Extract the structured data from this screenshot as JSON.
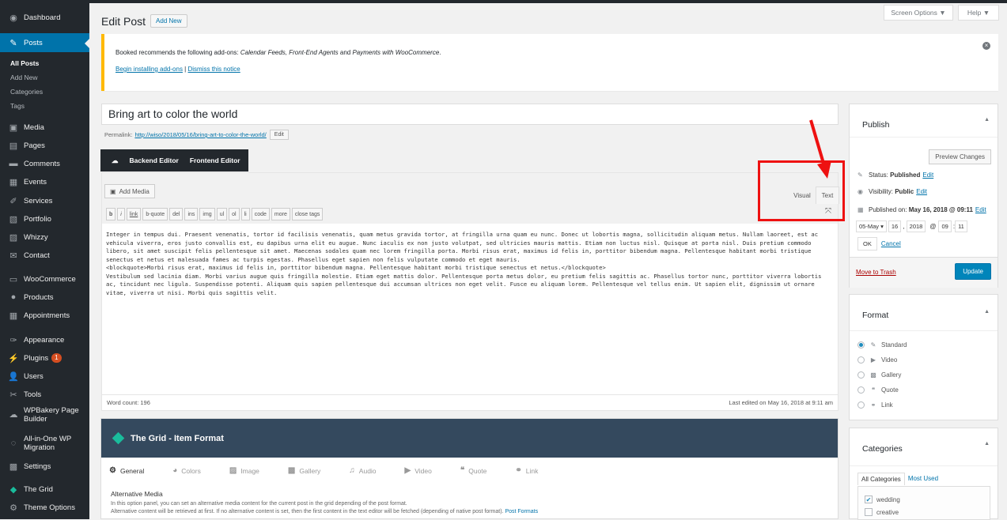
{
  "admin_menu": {
    "items": [
      {
        "label": "Dashboard",
        "icon": "dashboard-icon"
      },
      {
        "label": "Posts",
        "icon": "pin-icon"
      },
      {
        "label": "Media",
        "icon": "media-icon"
      },
      {
        "label": "Pages",
        "icon": "pages-icon"
      },
      {
        "label": "Comments",
        "icon": "comments-icon"
      },
      {
        "label": "Events",
        "icon": "calendar-icon"
      },
      {
        "label": "Services",
        "icon": "services-icon"
      },
      {
        "label": "Portfolio",
        "icon": "portfolio-icon"
      },
      {
        "label": "Whizzy",
        "icon": "whizzy-icon"
      },
      {
        "label": "Contact",
        "icon": "mail-icon"
      },
      {
        "label": "WooCommerce",
        "icon": "woo-icon"
      },
      {
        "label": "Products",
        "icon": "products-icon"
      },
      {
        "label": "Appointments",
        "icon": "calendar-icon"
      },
      {
        "label": "Appearance",
        "icon": "brush-icon"
      },
      {
        "label": "Plugins",
        "icon": "plugin-icon",
        "badge": "1"
      },
      {
        "label": "Users",
        "icon": "users-icon"
      },
      {
        "label": "Tools",
        "icon": "tools-icon"
      },
      {
        "label": "WPBakery Page Builder",
        "icon": "wpbakery-icon"
      },
      {
        "label": "All-in-One WP Migration",
        "icon": "migration-icon"
      },
      {
        "label": "Settings",
        "icon": "settings-icon"
      },
      {
        "label": "The Grid",
        "icon": "grid-icon"
      },
      {
        "label": "Theme Options",
        "icon": "gear-icon"
      }
    ],
    "posts_sub": [
      "All Posts",
      "Add New",
      "Categories",
      "Tags"
    ]
  },
  "top": {
    "screen_options": "Screen Options ▼",
    "help": "Help ▼"
  },
  "header": {
    "title": "Edit Post",
    "add_new": "Add New"
  },
  "notice": {
    "text_prefix": "Booked recommends the following add-ons: ",
    "addons": "Calendar Feeds, Front-End Agents",
    "text_and": " and ",
    "addon_last": "Payments with WooCommerce",
    "text_suffix": ".",
    "install_link": "Begin installing add-ons",
    "separator": " | ",
    "dismiss_link": "Dismiss this notice"
  },
  "post": {
    "title": "Bring art to color the world",
    "permalink_label": "Permalink:",
    "permalink_url": "http://wiso/2018/05/16/bring-art-to-color-the-world/",
    "permalink_edit": "Edit"
  },
  "builder": {
    "backend": "Backend Editor",
    "frontend": "Frontend Editor"
  },
  "editor": {
    "add_media": "Add Media",
    "tab_visual": "Visual",
    "tab_text": "Text",
    "quicktags": [
      "b",
      "i",
      "link",
      "b-quote",
      "del",
      "ins",
      "img",
      "ul",
      "ol",
      "li",
      "code",
      "more",
      "close tags"
    ],
    "content": "Integer in tempus dui. Praesent venenatis, tortor id facilisis venenatis, quam metus gravida tortor, at fringilla urna quam eu nunc. Donec ut lobortis magna, sollicitudin aliquam metus. Nullam laoreet, est ac vehicula viverra, eros justo convallis est, eu dapibus urna elit eu augue. Nunc iaculis ex non justo volutpat, sed ultricies mauris mattis. Etiam non luctus nisl. Quisque at porta nisl. Duis pretium commodo libero, sit amet suscipit felis pellentesque sit amet. Maecenas sodales quam nec lorem fringilla porta. Morbi risus erat, maximus id felis in, porttitor bibendum magna. Pellentesque habitant morbi tristique senectus et netus et malesuada fames ac turpis egestas. Phasellus eget sapien non felis vulputate commodo et eget mauris.\n<blockquote>Morbi risus erat, maximus id felis in, porttitor bibendum magna. Pellentesque habitant morbi tristique senectus et netus.</blockquote>\nVestibulum sed lacinia diam. Morbi varius augue quis fringilla molestie. Etiam eget mattis dolor. Pellentesque porta metus dolor, eu pretium felis sagittis ac. Phasellus tortor nunc, porttitor viverra lobortis ac, tincidunt nec ligula. Suspendisse potenti. Aliquam quis sapien pellentesque dui accumsan ultrices non eget velit. Fusce eu aliquam lorem. Pellentesque vel tellus enim. Ut sapien elit, dignissim ut ornare vitae, viverra ut nisi. Morbi quis sagittis velit.",
    "word_count": "Word count: 196",
    "last_edited": "Last edited on May 16, 2018 at 9:11 am"
  },
  "grid": {
    "title": "The Grid - Item Format",
    "tabs": [
      "General",
      "Colors",
      "Image",
      "Gallery",
      "Audio",
      "Video",
      "Quote",
      "Link"
    ],
    "section": "Alternative Media",
    "desc1": "In this option panel, you can set an alternative media content for the current post in the grid depending of the post format.",
    "desc2": "Alternative content will be retrieved at first. If no alternative content is set, then the first content in the text editor will be fetched (depending of native post format).",
    "desc2_link": "Post Formats"
  },
  "publish": {
    "title": "Publish",
    "preview": "Preview Changes",
    "status_label": "Status:",
    "status_value": "Published",
    "visibility_label": "Visibility:",
    "visibility_value": "Public",
    "published_label": "Published on:",
    "published_value": "May 16, 2018 @ 09:11",
    "edit": "Edit",
    "month": "05-May",
    "day": "16",
    "year": "2018",
    "at": "@",
    "hour": "09",
    "minute": "11",
    "ok": "OK",
    "cancel": "Cancel",
    "trash": "Move to Trash",
    "update": "Update"
  },
  "format": {
    "title": "Format",
    "options": [
      {
        "label": "Standard",
        "icon": "pin-icon",
        "checked": true
      },
      {
        "label": "Video",
        "icon": "video-icon",
        "checked": false
      },
      {
        "label": "Gallery",
        "icon": "gallery-icon",
        "checked": false
      },
      {
        "label": "Quote",
        "icon": "quote-icon",
        "checked": false
      },
      {
        "label": "Link",
        "icon": "link-icon",
        "checked": false
      }
    ]
  },
  "categories": {
    "title": "Categories",
    "tab_all": "All Categories",
    "tab_used": "Most Used",
    "items": [
      {
        "label": "wedding",
        "checked": true
      },
      {
        "label": "creative",
        "checked": false
      }
    ]
  },
  "colors": {
    "accent": "#0073aa",
    "sidebar": "#23282d",
    "highlight": "#ee1111"
  }
}
